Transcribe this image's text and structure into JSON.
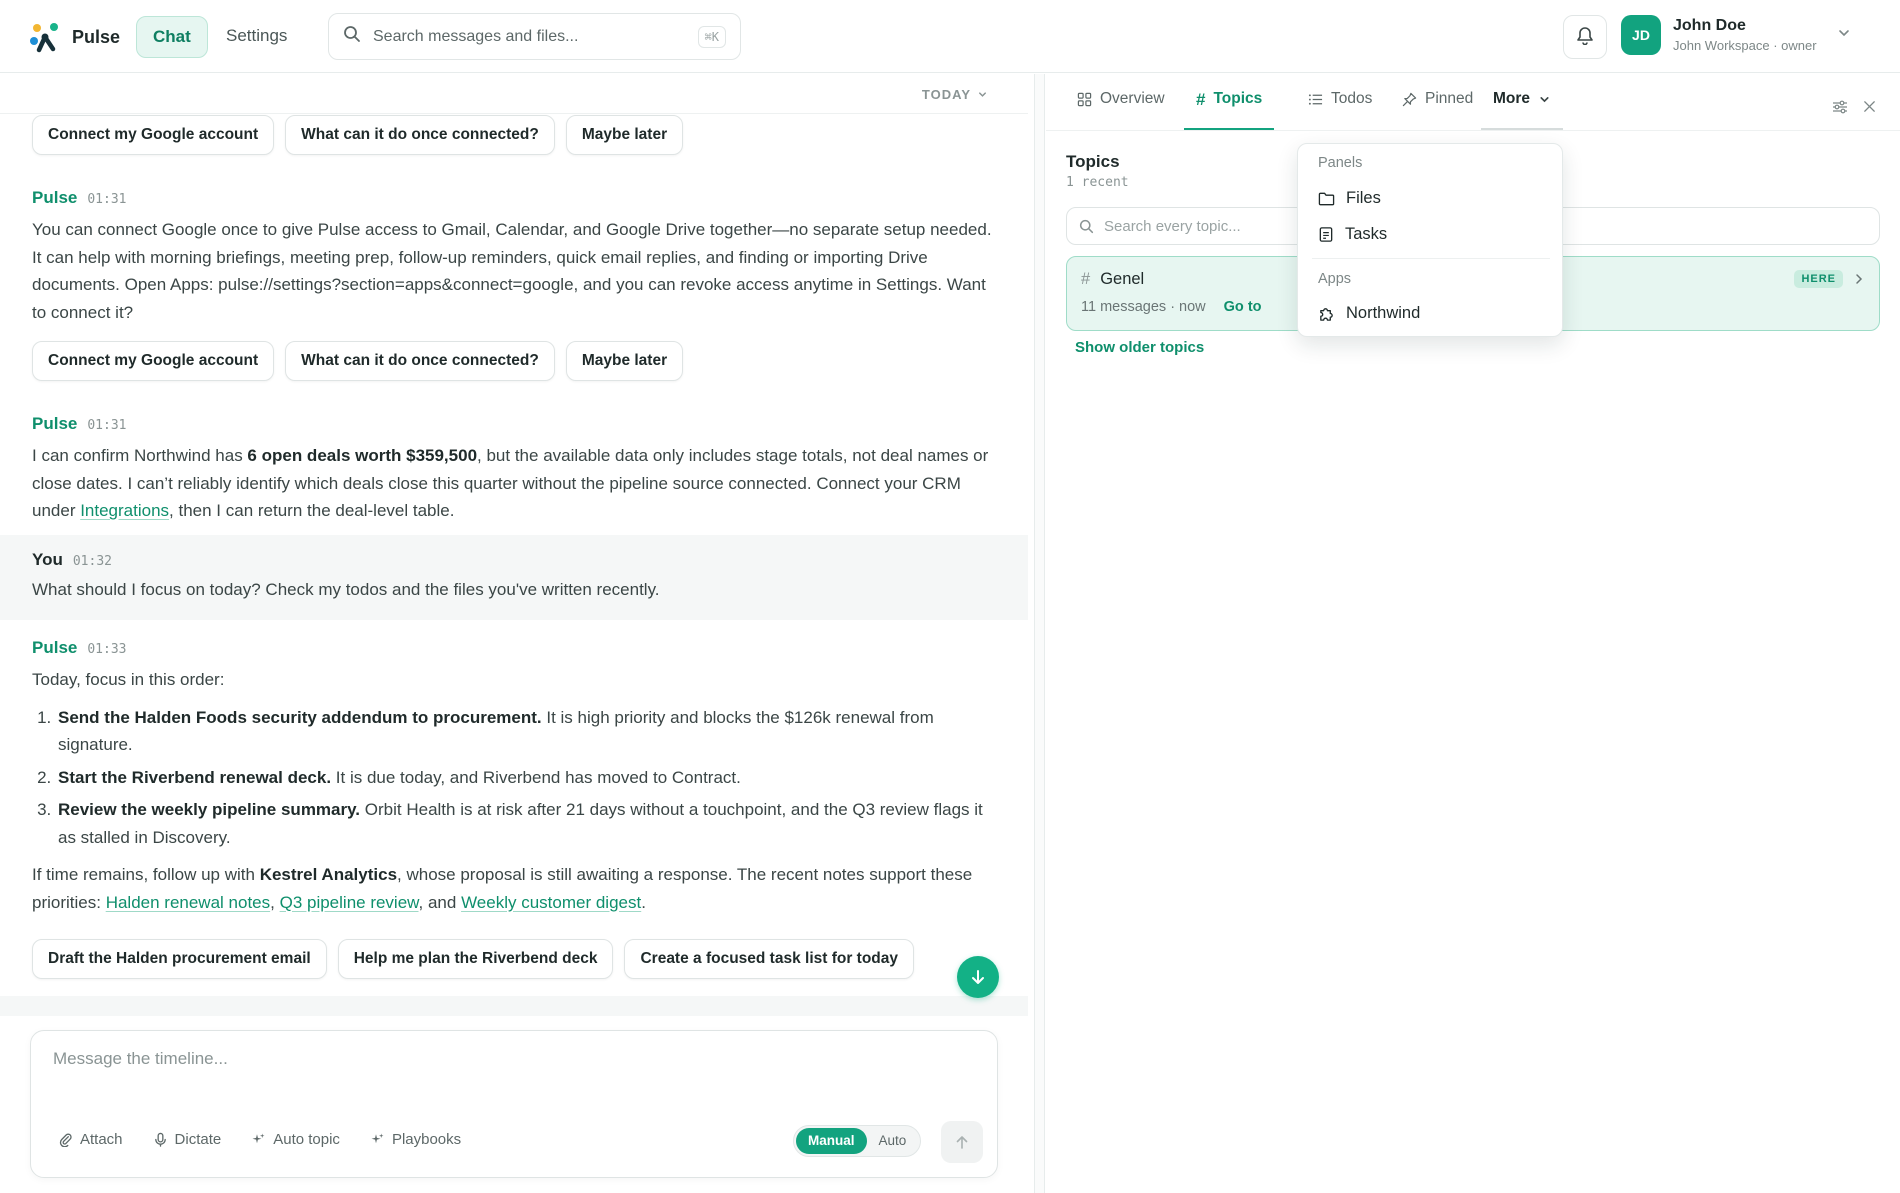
{
  "app": {
    "name": "Pulse",
    "nav": {
      "chat": "Chat",
      "settings": "Settings"
    },
    "search": {
      "placeholder": "Search messages and files...",
      "shortcut": "⌘K"
    },
    "user": {
      "initials": "JD",
      "name": "John Doe",
      "workspace": "John Workspace · owner"
    }
  },
  "chat": {
    "date_label": "TODAY",
    "top_chips": [
      "Connect my Google account",
      "What can it do once connected?",
      "Maybe later"
    ],
    "messages": [
      {
        "sender": "Pulse",
        "time": "01:31",
        "text": "You can connect Google once to give Pulse access to Gmail, Calendar, and Google Drive together—no separate setup needed. It can help with morning briefings, meeting prep, follow-up reminders, quick email replies, and finding or importing Drive documents. Open Apps: pulse://settings?section=apps&connect=google, and you can revoke access anytime in Settings. Want to connect it?",
        "chips": [
          "Connect my Google account",
          "What can it do once connected?",
          "Maybe later"
        ]
      },
      {
        "sender": "Pulse",
        "time": "01:31",
        "pre": "I can confirm Northwind has ",
        "bold": "6 open deals worth $359,500",
        "mid": ", but the available data only includes stage totals, not deal names or close dates. I can’t reliably identify which deals close this quarter without the pipeline source connected. Connect your CRM under ",
        "link": "Integrations",
        "post": ", then I can return the deal-level table."
      },
      {
        "sender": "You",
        "time": "01:32",
        "text": "What should I focus on today? Check my todos and the files you've written recently."
      },
      {
        "sender": "Pulse",
        "time": "01:33",
        "intro": "Today, focus in this order:",
        "items": [
          {
            "bold": "Send the Halden Foods security addendum to procurement.",
            "text": " It is high priority and blocks the $126k renewal from signature."
          },
          {
            "bold": "Start the Riverbend renewal deck.",
            "text": " It is due today, and Riverbend has moved to Contract."
          },
          {
            "bold": "Review the weekly pipeline summary.",
            "text": " Orbit Health is at risk after 21 days without a touchpoint, and the Q3 review flags it as stalled in Discovery."
          }
        ],
        "outro_pre": "If time remains, follow up with ",
        "outro_bold": "Kestrel Analytics",
        "outro_mid": ", whose proposal is still awaiting a response. The recent notes support these priorities: ",
        "links": [
          "Halden renewal notes",
          "Q3 pipeline review",
          "Weekly customer digest"
        ],
        "sep1": ", ",
        "sep2": ", and ",
        "end": ".",
        "chips": [
          "Draft the Halden procurement email",
          "Help me plan the Riverbend deck",
          "Create a focused task list for today"
        ]
      }
    ],
    "composer": {
      "placeholder": "Message the timeline...",
      "tools": [
        "Attach",
        "Dictate",
        "Auto topic",
        "Playbooks"
      ],
      "mode_manual": "Manual",
      "mode_auto": "Auto",
      "mode_selected": "Manual"
    }
  },
  "panel": {
    "tabs": [
      "Overview",
      "Topics",
      "Todos",
      "Pinned",
      "More"
    ],
    "active_tab": "Topics",
    "title": "Topics",
    "subtitle": "1 recent",
    "search_placeholder": "Search every topic...",
    "topic": {
      "name": "Genel",
      "meta": "11 messages · now",
      "goto": "Go to",
      "badge": "HERE"
    },
    "show_older": "Show older topics",
    "more_menu": {
      "panels_label": "Panels",
      "panels": [
        "Files",
        "Tasks"
      ],
      "apps_label": "Apps",
      "apps": [
        "Northwind"
      ]
    }
  },
  "colors": {
    "accent": "#13a37f",
    "accent_text": "#0f8f6c",
    "accent_bg": "#e7f6f1"
  }
}
